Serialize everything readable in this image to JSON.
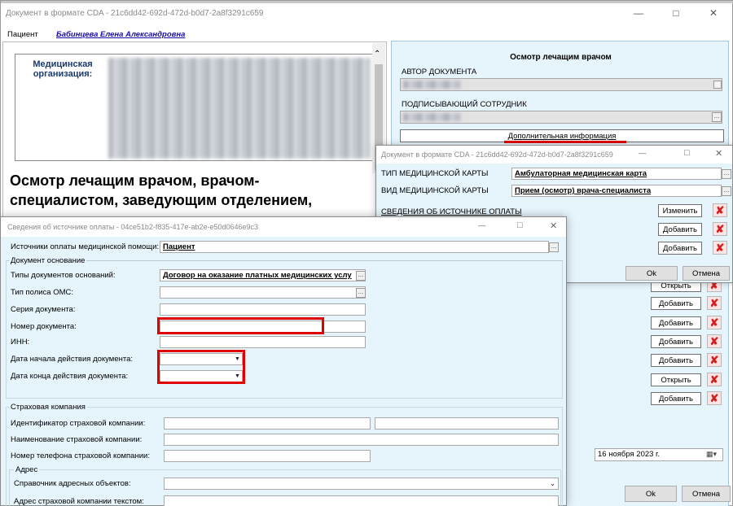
{
  "main_window": {
    "title": "Документ в формате CDA - 21c6dd42-692d-472d-b0d7-2a8f3291c659",
    "patient_label": "Пациент",
    "patient_name": "Бабинцева Елена Александровна",
    "org_label": "Медицинская организация:",
    "doc_heading": "Осмотр лечащим врачом, врачом-специалистом, заведующим отделением,",
    "right_title": "Осмотр лечащим врачом",
    "author_label": "АВТОР ДОКУМЕНТА",
    "signer_label": "ПОДПИСЫВАЮЩИЙ СОТРУДНИК",
    "extra_info_button": "Дополнительная информация",
    "row_buttons": [
      "Открыть",
      "Добавить",
      "Добавить",
      "Добавить",
      "Открыть",
      "Добавить"
    ],
    "date_value": "16  ноября  2023 г.",
    "ok_button": "Ok",
    "cancel_button": "Отмена"
  },
  "cda_dialog": {
    "title": "Документ в формате CDA - 21c6dd42-692d-472d-b0d7-2a8f3291c659",
    "card_type_label": "ТИП МЕДИЦИНСКОЙ КАРТЫ",
    "card_type_value": "Амбулаторная медицинская карта",
    "card_kind_label": "ВИД МЕДИЦИНСКОЙ КАРТЫ",
    "card_kind_value": "Прием (осмотр) врача-специалиста",
    "payment_link": "СВЕДЕНИЯ ОБ ИСТОЧНИКЕ ОПЛАТЫ",
    "change_button": "Изменить",
    "add_button": "Добавить",
    "ok_button": "Ok",
    "cancel_button": "Отмена"
  },
  "payment_dialog": {
    "title": "Сведения об источнике оплаты - 04ce51b2-f835-417e-ab2e-e50d0646e9c3",
    "source_label": "Источники оплаты медицинской помощи:",
    "source_value": "Пациент",
    "basis_group": "Документ основание",
    "doc_types_label": "Типы документов оснований:",
    "doc_types_value": "Договор на оказание платных медицинских услу",
    "oms_label": "Тип полиса ОМС:",
    "series_label": "Серия документа:",
    "number_label": "Номер документа:",
    "inn_label": "ИНН:",
    "start_date_label": "Дата начала действия документа:",
    "end_date_label": "Дата конца действия документа:",
    "insurance_group": "Страховая компания",
    "insurer_id_label": "Идентификатор страховой компании:",
    "insurer_name_label": "Наименование страховой компании:",
    "insurer_phone_label": "Номер телефона страховой компании:",
    "address_group": "Адрес",
    "address_ref_label": "Справочник адресных объектов:",
    "address_text_label": "Адрес страховой компании текстом:"
  },
  "colors": {
    "highlight": "#e00000",
    "dialog_bg": "#e6f4fb",
    "link": "#1a0dab"
  }
}
